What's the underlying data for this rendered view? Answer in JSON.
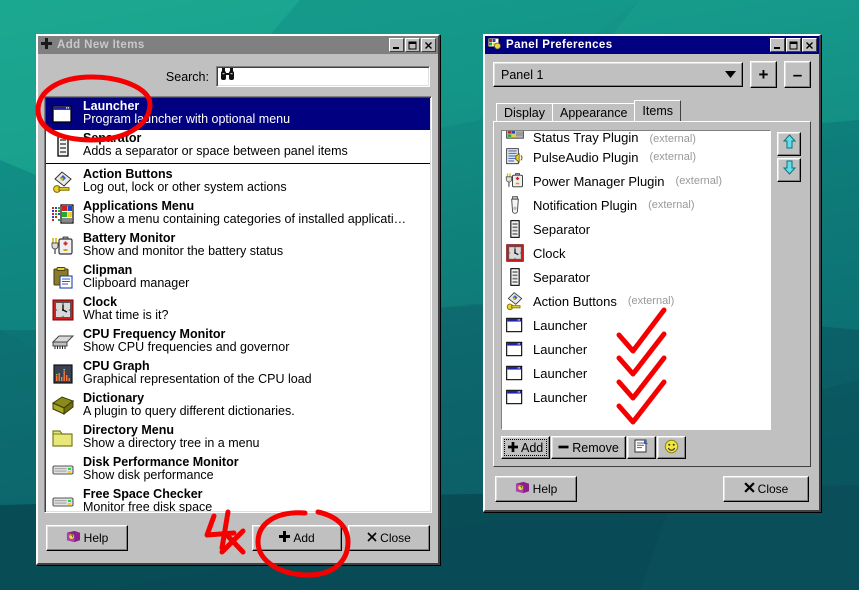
{
  "desktop": {
    "bg_top": "#18a08c",
    "bg_bottom": "#0a4f58"
  },
  "annotations": {
    "accent": "#f50000",
    "repeat_note": "4x",
    "check_count": 4,
    "circle_launcher_row": true,
    "circle_add_button": true
  },
  "add_window": {
    "title": "Add New Items",
    "title_icon": "plus-icon",
    "active": false,
    "titlebar_buttons": [
      {
        "name": "minimize-button",
        "glyph": "_"
      },
      {
        "name": "maximize-button",
        "glyph": "□"
      },
      {
        "name": "close-button",
        "glyph": "✕"
      }
    ],
    "search": {
      "label": "Search:",
      "value": "",
      "placeholder": "",
      "icon": "binoculars-icon"
    },
    "items": [
      {
        "title": "Launcher",
        "desc": "Program launcher with optional menu",
        "icon": "launcher-icon",
        "selected": true
      },
      {
        "title": "Separator",
        "desc": "Adds a separator or space between panel items",
        "icon": "separator-icon",
        "selected": false,
        "divider_after": true
      },
      {
        "title": "Action Buttons",
        "desc": "Log out, lock or other system actions",
        "icon": "action-buttons-icon",
        "selected": false
      },
      {
        "title": "Applications Menu",
        "desc": "Show a menu containing categories of installed applicati…",
        "icon": "applications-menu-icon",
        "selected": false
      },
      {
        "title": "Battery Monitor",
        "desc": "Show and monitor the battery status",
        "icon": "battery-icon",
        "selected": false
      },
      {
        "title": "Clipman",
        "desc": "Clipboard manager",
        "icon": "clipboard-icon",
        "selected": false
      },
      {
        "title": "Clock",
        "desc": "What time is it?",
        "icon": "clock-icon",
        "selected": false
      },
      {
        "title": "CPU Frequency Monitor",
        "desc": "Show CPU frequencies and governor",
        "icon": "cpu-chip-icon",
        "selected": false
      },
      {
        "title": "CPU Graph",
        "desc": "Graphical representation of the CPU load",
        "icon": "cpu-graph-icon",
        "selected": false
      },
      {
        "title": "Dictionary",
        "desc": "A plugin to query different dictionaries.",
        "icon": "book-icon",
        "selected": false
      },
      {
        "title": "Directory Menu",
        "desc": "Show a directory tree in a menu",
        "icon": "folder-icon",
        "selected": false
      },
      {
        "title": "Disk Performance Monitor",
        "desc": "Show disk performance",
        "icon": "disk-icon",
        "selected": false
      },
      {
        "title": "Free Space Checker",
        "desc": "Monitor free disk space",
        "icon": "disk-icon",
        "selected": false
      }
    ],
    "footer": {
      "help_label": "Help",
      "help_icon": "help-book-icon",
      "add_label": "Add",
      "add_icon": "plus-icon",
      "close_label": "Close",
      "close_icon": "x-icon"
    }
  },
  "prefs_window": {
    "title": "Panel Preferences",
    "title_icon": "panel-settings-icon",
    "active": true,
    "titlebar_buttons": [
      {
        "name": "minimize-button",
        "glyph": "_"
      },
      {
        "name": "maximize-button",
        "glyph": "□"
      },
      {
        "name": "close-button",
        "glyph": "✕"
      }
    ],
    "panel_selector": {
      "value": "Panel 1",
      "options": [
        "Panel 1"
      ],
      "add_panel_label": "+",
      "remove_panel_label": "–"
    },
    "tabs": [
      {
        "label": "Display",
        "active": false
      },
      {
        "label": "Appearance",
        "active": false
      },
      {
        "label": "Items",
        "active": true
      }
    ],
    "items": [
      {
        "label": "Status Tray Plugin",
        "external": "(external)",
        "icon": "status-tray-icon",
        "clipped": true
      },
      {
        "label": "PulseAudio Plugin",
        "external": "(external)",
        "icon": "pulseaudio-icon"
      },
      {
        "label": "Power Manager Plugin",
        "external": "(external)",
        "icon": "power-manager-icon"
      },
      {
        "label": "Notification Plugin",
        "external": "(external)",
        "icon": "notification-icon"
      },
      {
        "label": "Separator",
        "external": "",
        "icon": "separator-icon"
      },
      {
        "label": "Clock",
        "external": "",
        "icon": "clock-icon"
      },
      {
        "label": "Separator",
        "external": "",
        "icon": "separator-icon"
      },
      {
        "label": "Action Buttons",
        "external": "(external)",
        "icon": "action-buttons-icon"
      },
      {
        "label": "Launcher",
        "external": "",
        "icon": "launcher-icon"
      },
      {
        "label": "Launcher",
        "external": "",
        "icon": "launcher-icon"
      },
      {
        "label": "Launcher",
        "external": "",
        "icon": "launcher-icon"
      },
      {
        "label": "Launcher",
        "external": "",
        "icon": "launcher-icon"
      }
    ],
    "move_buttons": [
      {
        "name": "move-item-up-button",
        "icon": "arrow-up-icon"
      },
      {
        "name": "move-item-down-button",
        "icon": "arrow-down-icon"
      }
    ],
    "toolbar": {
      "add_label": "Add",
      "add_icon": "plus-icon",
      "remove_label": "Remove",
      "remove_icon": "minus-icon",
      "properties_icon": "properties-icon",
      "about_icon": "smiley-icon"
    },
    "footer": {
      "help_label": "Help",
      "help_icon": "help-book-icon",
      "close_label": "Close",
      "close_icon": "x-icon"
    }
  }
}
